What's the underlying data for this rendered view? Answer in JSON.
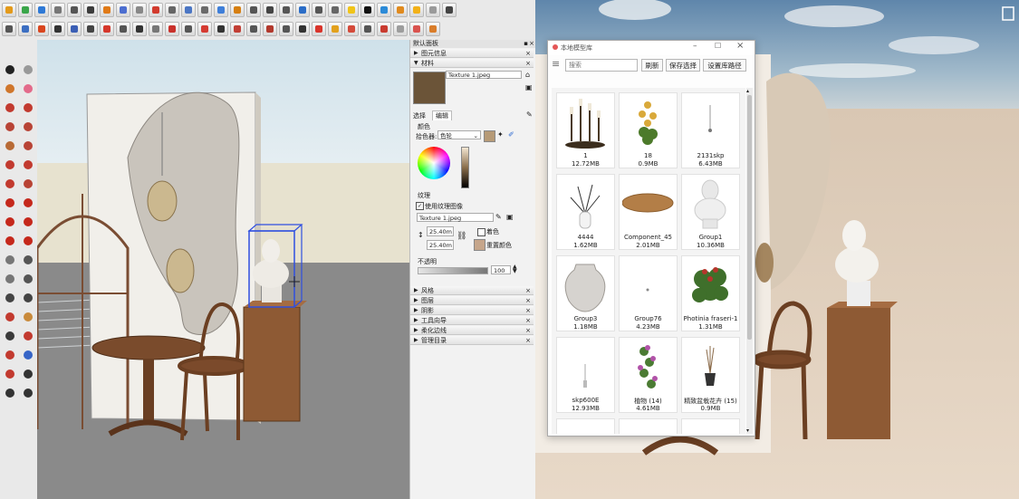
{
  "tray": {
    "title": "默认面板",
    "sections_top": [
      "图元信息",
      "材料"
    ],
    "material": {
      "name": "Texture 1.jpeg",
      "swatch_color": "#6b5438"
    },
    "tabs": [
      "选择",
      "编辑"
    ],
    "color_heading": "颜色",
    "picker_label": "拾色器:",
    "picker_value": "色轮",
    "texture_heading": "纹理",
    "use_texture_label": "使用纹理图像",
    "texture_file": "Texture 1.jpeg",
    "width_value": "25.40m",
    "height_value": "25.40m",
    "colorize_label": "着色",
    "reset_color_label": "重置颜色",
    "opacity_heading": "不透明",
    "opacity_value": "100",
    "sections_bottom": [
      "风格",
      "图层",
      "阴影",
      "工具向导",
      "柔化边线",
      "管理目录"
    ]
  },
  "library": {
    "title": "本地模型库",
    "search_placeholder": "搜索",
    "refresh_label": "刷新",
    "save_label": "保存选择",
    "set_path_label": "设置库路径",
    "items": [
      {
        "name": "1",
        "size": "12.72MB"
      },
      {
        "name": "18",
        "size": "0.9MB"
      },
      {
        "name": "2131skp",
        "size": "6.43MB"
      },
      {
        "name": "4444",
        "size": "1.62MB"
      },
      {
        "name": "Component_45",
        "size": "2.01MB"
      },
      {
        "name": "Group1",
        "size": "10.36MB"
      },
      {
        "name": "Group3",
        "size": "1.18MB"
      },
      {
        "name": "Group76",
        "size": "4.23MB"
      },
      {
        "name": "Photinia fraseri-1",
        "size": "1.31MB"
      },
      {
        "name": "skp600E",
        "size": "12.93MB"
      },
      {
        "name": "植物 (14)",
        "size": "4.61MB"
      },
      {
        "name": "精致盆栽花卉 (15)",
        "size": "0.9MB"
      }
    ]
  },
  "colors": {
    "accent": "#1e5ad6",
    "selection_box": "#2f4fe0"
  }
}
